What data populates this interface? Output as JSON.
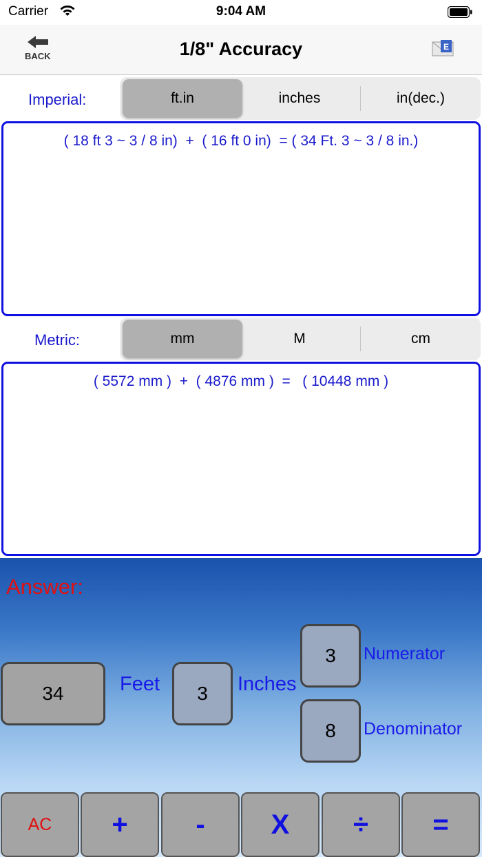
{
  "status_bar": {
    "carrier": "Carrier",
    "time": "9:04 AM"
  },
  "nav": {
    "back_label": "BACK",
    "title": "1/8\" Accuracy",
    "mail_letter": "E"
  },
  "imperial": {
    "label": "Imperial:",
    "segments": [
      "ft.in",
      "inches",
      "in(dec.)"
    ],
    "selected": "ft.in",
    "result": "( 18 ft 3 ~ 3 / 8 in)  +  ( 16 ft 0 in)  = ( 34 Ft. 3 ~ 3 / 8 in.)"
  },
  "metric": {
    "label": "Metric:",
    "segments": [
      "mm",
      "M",
      "cm"
    ],
    "selected": "mm",
    "result": "( 5572 mm )  +  ( 4876 mm )  =   ( 10448 mm )"
  },
  "answer": {
    "label": "Answer:",
    "feet_value": "34",
    "feet_label": "Feet",
    "inches_value": "3",
    "inches_label": "Inches",
    "numerator_value": "3",
    "numerator_label": "Numerator",
    "denominator_value": "8",
    "denominator_label": "Denominator"
  },
  "operators": [
    "AC",
    "+",
    "-",
    "X",
    "÷",
    "="
  ],
  "colors": {
    "accent_blue": "#1a1acc",
    "answer_red": "#e01010",
    "box_border": "#1010e0"
  }
}
